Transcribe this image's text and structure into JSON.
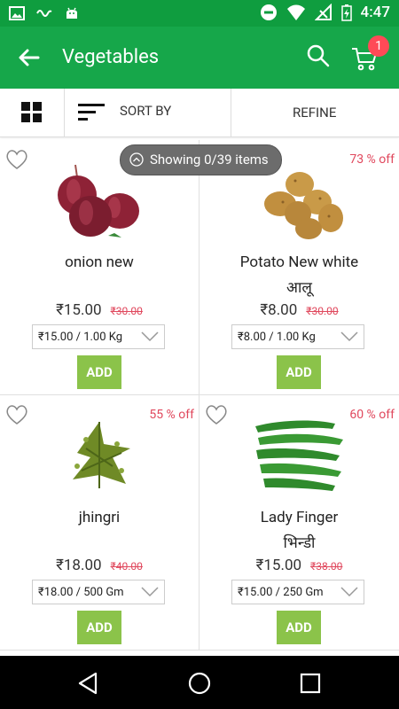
{
  "status": {
    "time": "4:47"
  },
  "header": {
    "title": "Vegetables",
    "cart_count": "1"
  },
  "toolbar": {
    "sort_label": "SORT BY",
    "refine_label": "REFINE"
  },
  "banner": {
    "text": "Showing 0/39 items"
  },
  "products": [
    {
      "name": "onion new",
      "subname": "",
      "price": "₹15.00",
      "mrp": "₹30.00",
      "discount": "",
      "option": "₹15.00 / 1.00 Kg",
      "add_label": "ADD",
      "image": "onion-image"
    },
    {
      "name": "Potato New white",
      "subname": "आलू",
      "price": "₹8.00",
      "mrp": "₹30.00",
      "discount": "73 % off",
      "option": "₹8.00 / 1.00 Kg",
      "add_label": "ADD",
      "image": "potato-image"
    },
    {
      "name": "jhingri",
      "subname": "",
      "price": "₹18.00",
      "mrp": "₹40.00",
      "discount": "55 % off",
      "option": "₹18.00 / 500 Gm",
      "add_label": "ADD",
      "image": "jhingri-image"
    },
    {
      "name": "Lady Finger",
      "subname": "भिन्डी",
      "price": "₹15.00",
      "mrp": "₹38.00",
      "discount": "60 % off",
      "option": "₹15.00 / 250 Gm",
      "add_label": "ADD",
      "image": "lady-finger-image"
    }
  ],
  "colors": {
    "primary": "#16a74a",
    "status_bar": "#0f9d3f",
    "accent_add": "#8bc34a",
    "discount": "#e0485d",
    "badge": "#ff4a57"
  },
  "icons": [
    "back-arrow-icon",
    "search-icon",
    "cart-icon",
    "grid-view-icon",
    "sort-icon",
    "heart-icon",
    "chevron-down-icon",
    "chevron-up-circle-icon",
    "nav-back-icon",
    "nav-home-icon",
    "nav-recents-icon"
  ]
}
